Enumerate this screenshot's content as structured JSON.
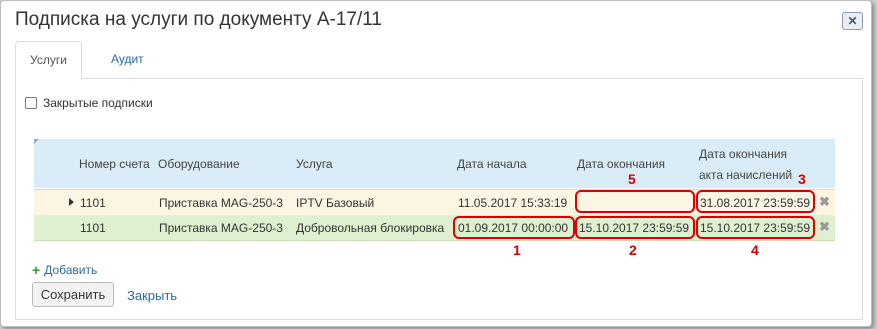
{
  "dialog": {
    "title": "Подписка на услуги по документу А-17/11",
    "close_icon": "close-icon"
  },
  "tabs": [
    {
      "label": "Услуги",
      "active": true
    },
    {
      "label": "Аудит",
      "active": false
    }
  ],
  "filters": {
    "closed_subscriptions_label": "Закрытые подписки",
    "closed_subscriptions_checked": false
  },
  "grid": {
    "columns": {
      "account": "Номер счета",
      "equipment": "Оборудование",
      "service": "Услуга",
      "start_date": "Дата начала",
      "end_date": "Дата окончания",
      "act_end_line1": "Дата окончания",
      "act_end_line2": "акта начислений"
    },
    "rows": [
      {
        "account": "1101",
        "equipment": "Приставка MAG-250-3",
        "service": "IPTV Базовый",
        "start_date": "11.05.2017 15:33:19",
        "end_date": "",
        "act_end": "31.08.2017 23:59:59",
        "expanded_arrow": true
      },
      {
        "account": "1101",
        "equipment": "Приставка MAG-250-3",
        "service": "Добровольная блокировка",
        "start_date": "01.09.2017 00:00:00",
        "end_date": "15.10.2017 23:59:59",
        "act_end": "15.10.2017 23:59:59",
        "expanded_arrow": false
      }
    ]
  },
  "annotations": {
    "n1": "1",
    "n2": "2",
    "n3": "3",
    "n4": "4",
    "n5": "5",
    "color": "#d40000"
  },
  "actions": {
    "add_label": "Добавить",
    "save_label": "Сохранить",
    "cancel_label": "Закрыть"
  }
}
